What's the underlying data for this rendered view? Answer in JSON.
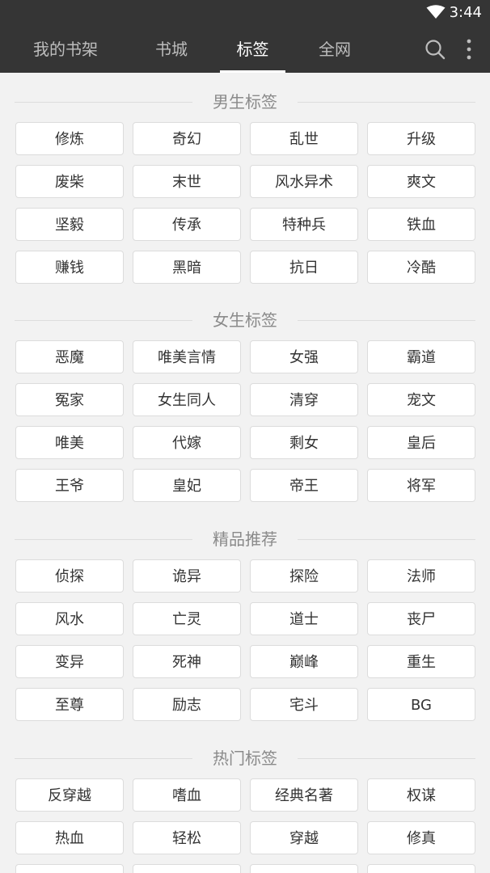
{
  "status_bar": {
    "time": "3:44"
  },
  "tabs": [
    {
      "label": "我的书架"
    },
    {
      "label": "书城"
    },
    {
      "label": "标签"
    },
    {
      "label": "全网"
    }
  ],
  "active_tab": "标签",
  "icons": {
    "search": "search-icon",
    "more": "more-vertical-icon",
    "wifi": "wifi-icon"
  },
  "sections": [
    {
      "title": "男生标签",
      "tags": [
        "修炼",
        "奇幻",
        "乱世",
        "升级",
        "废柴",
        "末世",
        "风水异术",
        "爽文",
        "坚毅",
        "传承",
        "特种兵",
        "铁血",
        "赚钱",
        "黑暗",
        "抗日",
        "冷酷"
      ]
    },
    {
      "title": "女生标签",
      "tags": [
        "恶魔",
        "唯美言情",
        "女强",
        "霸道",
        "冤家",
        "女生同人",
        "清穿",
        "宠文",
        "唯美",
        "代嫁",
        "剩女",
        "皇后",
        "王爷",
        "皇妃",
        "帝王",
        "将军"
      ]
    },
    {
      "title": "精品推荐",
      "tags": [
        "侦探",
        "诡异",
        "探险",
        "法师",
        "风水",
        "亡灵",
        "道士",
        "丧尸",
        "变异",
        "死神",
        "巅峰",
        "重生",
        "至尊",
        "励志",
        "宅斗",
        "BG"
      ]
    },
    {
      "title": "热门标签",
      "tags": [
        "反穿越",
        "嗜血",
        "经典名著",
        "权谋",
        "热血",
        "轻松",
        "穿越",
        "修真",
        "",
        "",
        "",
        ""
      ]
    }
  ],
  "colors": {
    "app_bar": "#353535",
    "background": "#f2f2f2",
    "tag_border": "#dcdcdc",
    "section_title": "#8a8a8a"
  }
}
